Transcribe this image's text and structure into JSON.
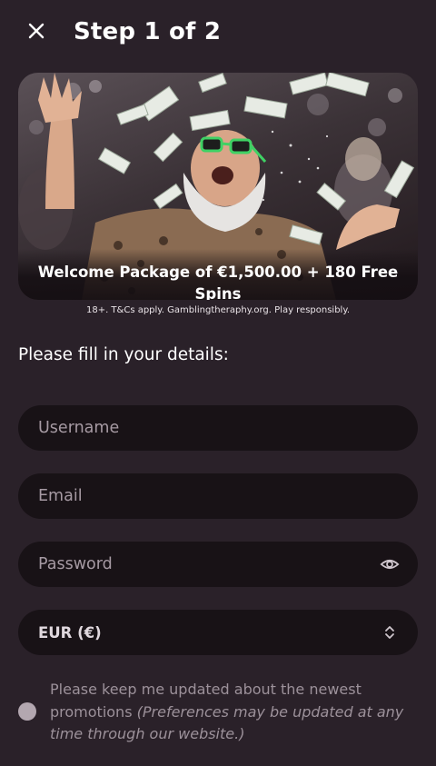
{
  "header": {
    "close_icon": "close-icon",
    "title": "Step 1 of 2"
  },
  "banner": {
    "caption": "Welcome Package of €1,500.00 + 180 Free Spins"
  },
  "disclaimer": "18+. T&Cs apply. Gamblingtheraphy.org. Play responsibly.",
  "form": {
    "heading": "Please fill in your details:",
    "username_placeholder": "Username",
    "email_placeholder": "Email",
    "password_placeholder": "Password",
    "password_icon": "eye-icon",
    "currency_value": "EUR (€)",
    "currency_icon": "chevron-up-down-icon"
  },
  "promotions": {
    "line1": "Please keep me updated about the newest promotions",
    "line2": "(Preferences may be updated at any time through our website.)"
  },
  "colors": {
    "background": "#2a2129",
    "field_background": "#181216",
    "placeholder": "#a69aa3",
    "radio": "#b3a7b0"
  }
}
